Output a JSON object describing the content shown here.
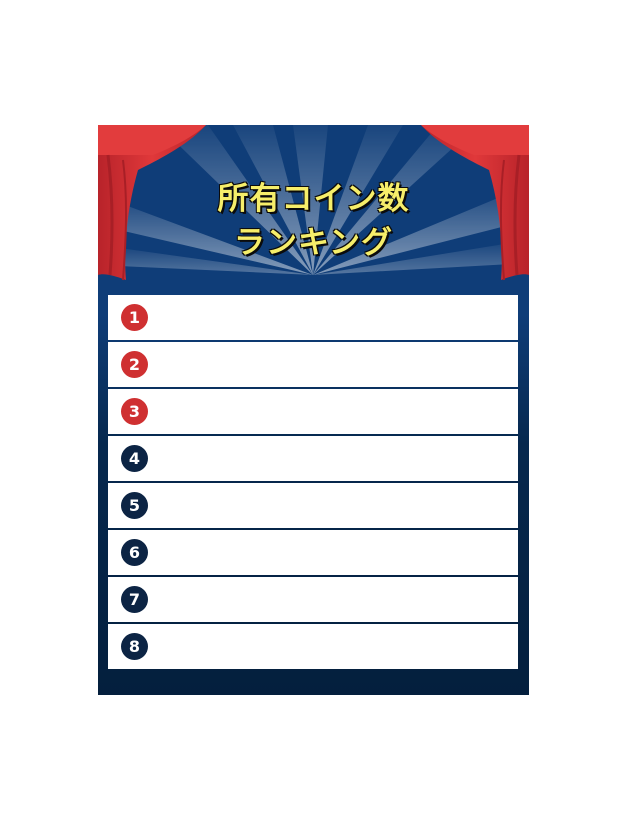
{
  "header": {
    "title_line1": "所有コイン数",
    "title_line2": "ランキング"
  },
  "colors": {
    "header_bg": "#0f3d78",
    "curtain": "#cf3031",
    "badge_top": "#cf3031",
    "badge_normal": "#0c2444",
    "title_text": "#f6ee6a"
  },
  "ranking": [
    {
      "rank": "1",
      "tier": "top",
      "name": ""
    },
    {
      "rank": "2",
      "tier": "top",
      "name": ""
    },
    {
      "rank": "3",
      "tier": "top",
      "name": ""
    },
    {
      "rank": "4",
      "tier": "normal",
      "name": ""
    },
    {
      "rank": "5",
      "tier": "normal",
      "name": ""
    },
    {
      "rank": "6",
      "tier": "normal",
      "name": ""
    },
    {
      "rank": "7",
      "tier": "normal",
      "name": ""
    },
    {
      "rank": "8",
      "tier": "normal",
      "name": ""
    }
  ]
}
